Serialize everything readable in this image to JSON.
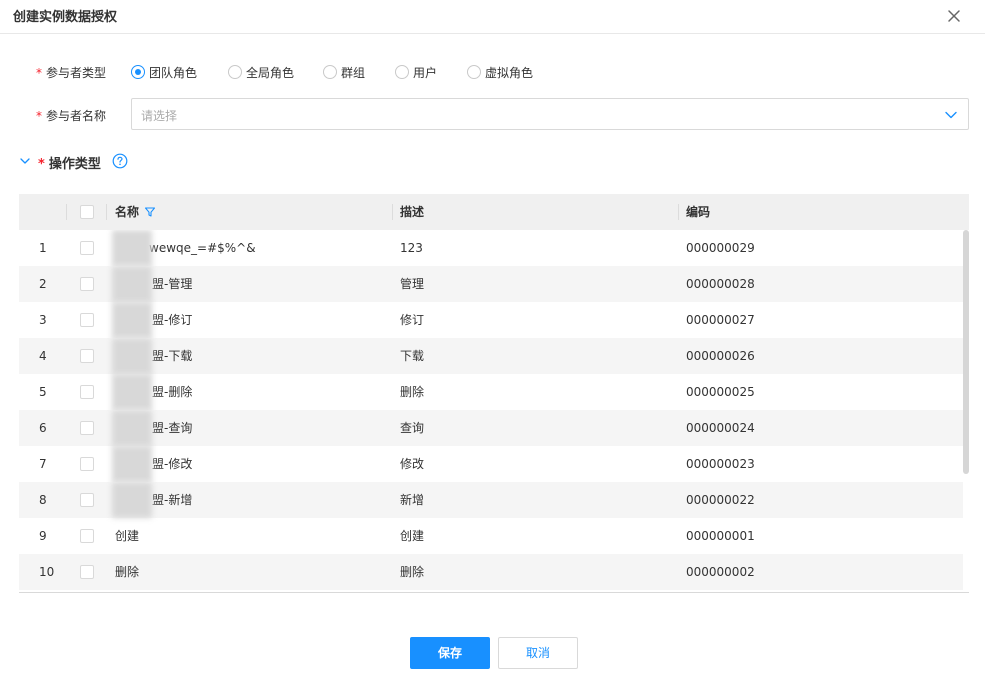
{
  "dialog": {
    "title": "创建实例数据授权"
  },
  "form": {
    "participant_type": {
      "required_mark": "*",
      "label": "参与者类型",
      "options": [
        {
          "label": "团队角色",
          "checked": true
        },
        {
          "label": "全局角色",
          "checked": false
        },
        {
          "label": "群组",
          "checked": false
        },
        {
          "label": "用户",
          "checked": false
        },
        {
          "label": "虚拟角色",
          "checked": false
        }
      ]
    },
    "participant_name": {
      "required_mark": "*",
      "label": "参与者名称",
      "placeholder": "请选择"
    },
    "operation_section": {
      "required_mark": "*",
      "title": "操作类型"
    }
  },
  "table": {
    "columns": [
      "名称",
      "描述",
      "编码"
    ],
    "rows": [
      {
        "index": "1",
        "name": "wewqe_=#$%^&",
        "desc": "123",
        "code": "000000029"
      },
      {
        "index": "2",
        "name": "盟-管理",
        "desc": "管理",
        "code": "000000028"
      },
      {
        "index": "3",
        "name": "盟-修订",
        "desc": "修订",
        "code": "000000027"
      },
      {
        "index": "4",
        "name": "盟-下载",
        "desc": "下载",
        "code": "000000026"
      },
      {
        "index": "5",
        "name": "盟-删除",
        "desc": "删除",
        "code": "000000025"
      },
      {
        "index": "6",
        "name": "盟-查询",
        "desc": "查询",
        "code": "000000024"
      },
      {
        "index": "7",
        "name": "盟-修改",
        "desc": "修改",
        "code": "000000023"
      },
      {
        "index": "8",
        "name": "盟-新增",
        "desc": "新增",
        "code": "000000022"
      },
      {
        "index": "9",
        "name": "创建",
        "desc": "创建",
        "code": "000000001"
      },
      {
        "index": "10",
        "name": "删除",
        "desc": "删除",
        "code": "000000002"
      }
    ]
  },
  "footer": {
    "save_label": "保存",
    "cancel_label": "取消"
  },
  "colors": {
    "accent": "#1890ff",
    "required": "#f5222d",
    "header_bg": "#f0f0f0"
  },
  "icons": {
    "close": "close-icon",
    "dropdown": "chevron-down-icon",
    "collapse": "chevron-down-icon",
    "help": "help-icon",
    "filter": "filter-icon"
  }
}
